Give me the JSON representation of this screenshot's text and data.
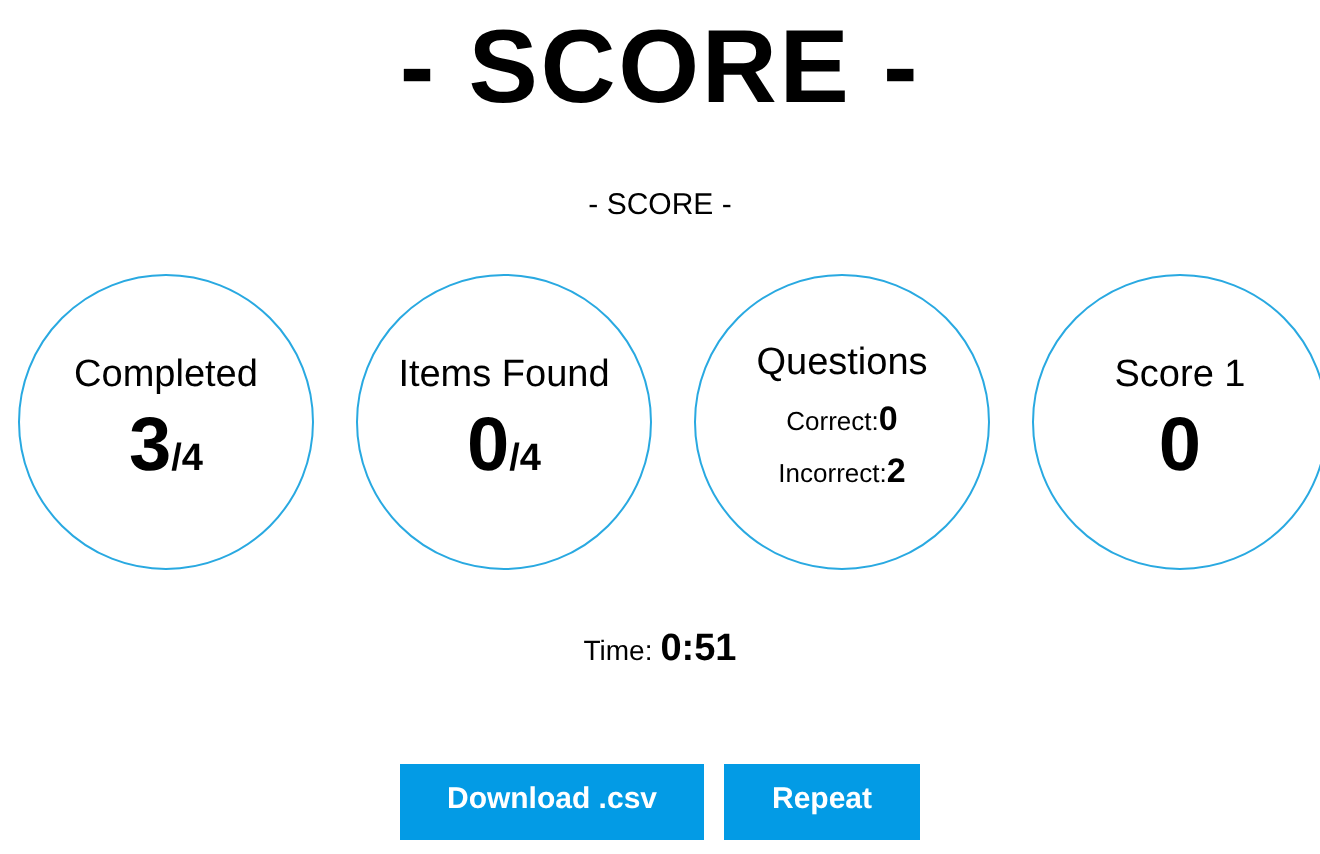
{
  "title": "- SCORE -",
  "subtitle": "- SCORE -",
  "stats": [
    {
      "kind": "fraction",
      "label": "Completed",
      "value": "3",
      "total": "/4"
    },
    {
      "kind": "fraction",
      "label": "Items Found",
      "value": "0",
      "total": "/4"
    },
    {
      "kind": "questions",
      "label": "Questions",
      "correct_label": "Correct:",
      "correct": "0",
      "incorrect_label": "Incorrect:",
      "incorrect": "2"
    },
    {
      "kind": "plain",
      "label": "Score 1",
      "value": "0"
    }
  ],
  "time": {
    "label": "Time:",
    "value": "0:51"
  },
  "buttons": [
    "Download .csv",
    "Repeat"
  ]
}
